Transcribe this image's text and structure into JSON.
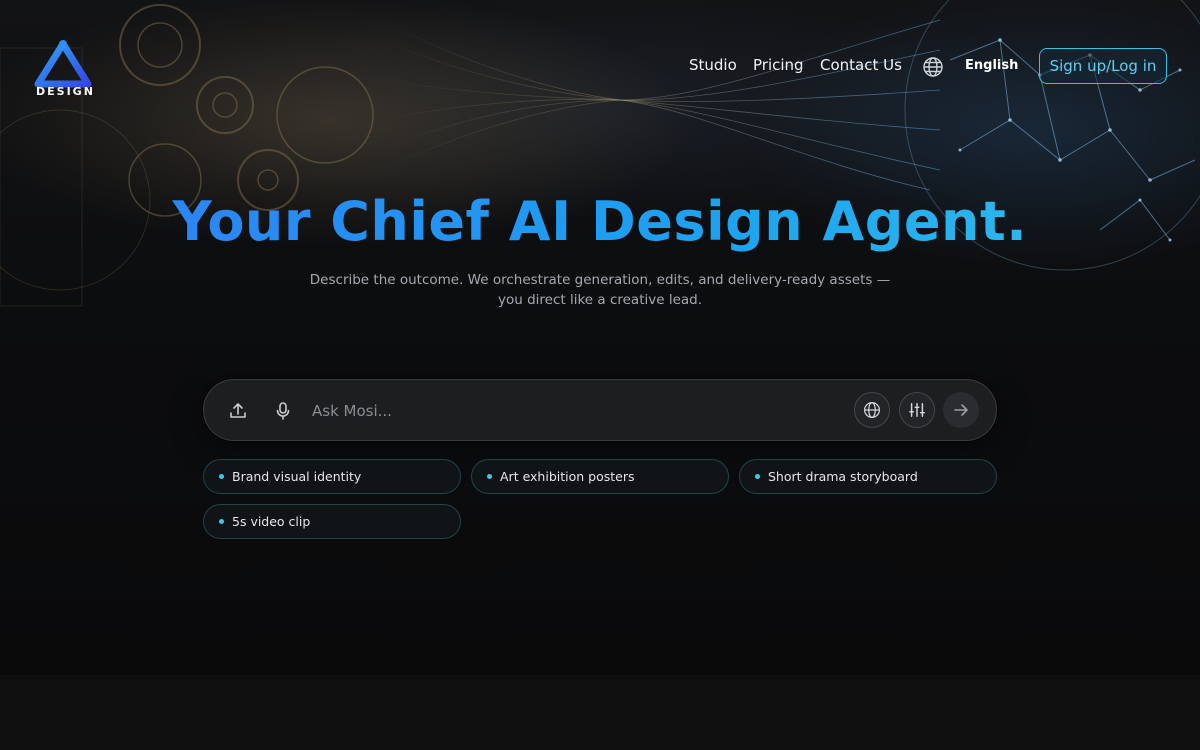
{
  "brand": {
    "logo_text": "DESIGN"
  },
  "nav": {
    "links": [
      "Studio",
      "Pricing",
      "Contact Us"
    ],
    "language": "English",
    "signup_label": "Sign up/Log in"
  },
  "hero": {
    "title": "Your Chief AI Design Agent.",
    "subtitle": "Describe the outcome. We orchestrate generation, edits, and delivery-ready assets — you direct like a creative lead."
  },
  "prompt": {
    "placeholder": "Ask Mosi...",
    "value": ""
  },
  "suggestions": [
    "Brand visual identity",
    "Art exhibition posters",
    "Short drama storyboard",
    "5s video clip"
  ],
  "colors": {
    "accent": "#37c1e6",
    "title_gradient_start": "#2f7cf5",
    "title_gradient_end": "#36c2ea",
    "background": "#0b0c0e"
  },
  "icons": {
    "upload": "upload-icon",
    "mic": "microphone-icon",
    "web": "globe-icon",
    "settings": "sliders-icon",
    "send": "arrow-right-icon"
  }
}
